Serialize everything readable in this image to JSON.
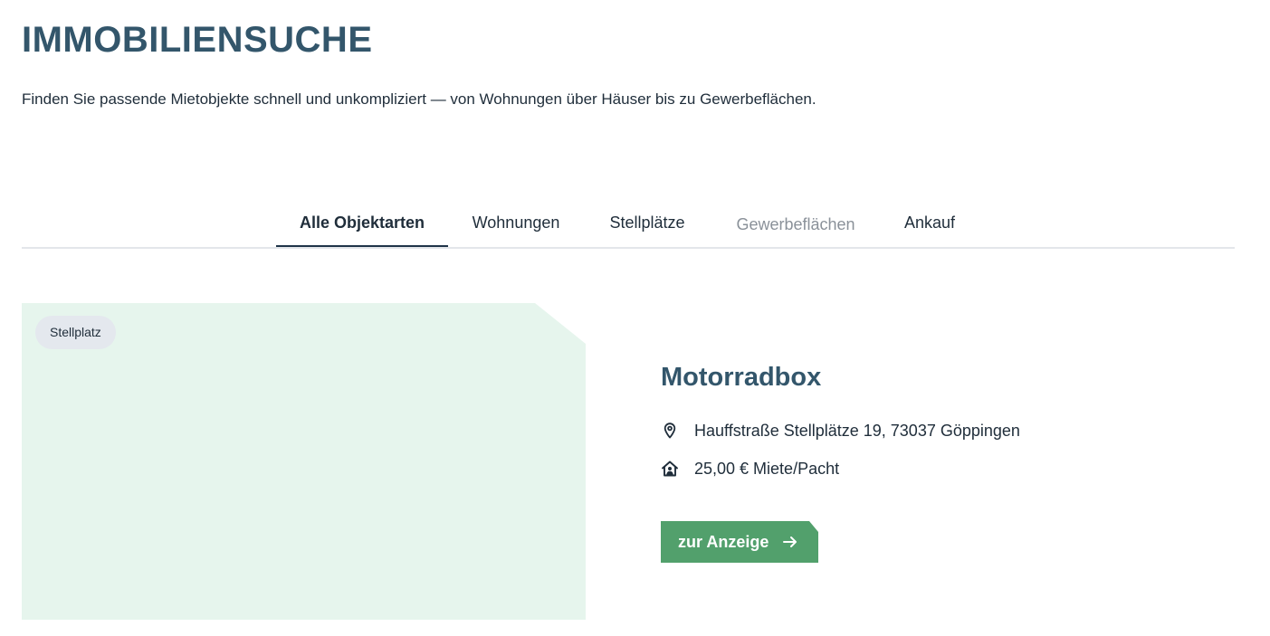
{
  "page": {
    "title": "IMMOBILIENSUCHE",
    "intro": "Finden Sie passende Mietobjekte schnell und unkompliziert — von Wohnungen über Häuser bis zu Gewerbeflächen."
  },
  "tabs": [
    {
      "label": "Alle Objektarten",
      "state": "active"
    },
    {
      "label": "Wohnungen",
      "state": "normal"
    },
    {
      "label": "Stellplätze",
      "state": "normal"
    },
    {
      "label": "Gewerbeflächen",
      "state": "disabled"
    },
    {
      "label": "Ankauf",
      "state": "normal"
    }
  ],
  "listing": {
    "badge": "Stellplatz",
    "title": "Motorradbox",
    "address": "Hauffstraße Stellplätze 19, 73037 Göppingen",
    "address_icon": "location-pin-icon",
    "price": "25,00 € Miete/Pacht",
    "price_icon": "house-person-icon",
    "cta_label": "zur Anzeige",
    "cta_icon": "arrow-right-icon"
  },
  "colors": {
    "heading": "#33566b",
    "text": "#1f2d3a",
    "image_placeholder": "#e6f5ed",
    "badge_bg": "#e4e8ee",
    "cta_bg": "#52a06c",
    "tab_active_underline": "#1f3448",
    "tab_disabled": "#8a9199"
  }
}
